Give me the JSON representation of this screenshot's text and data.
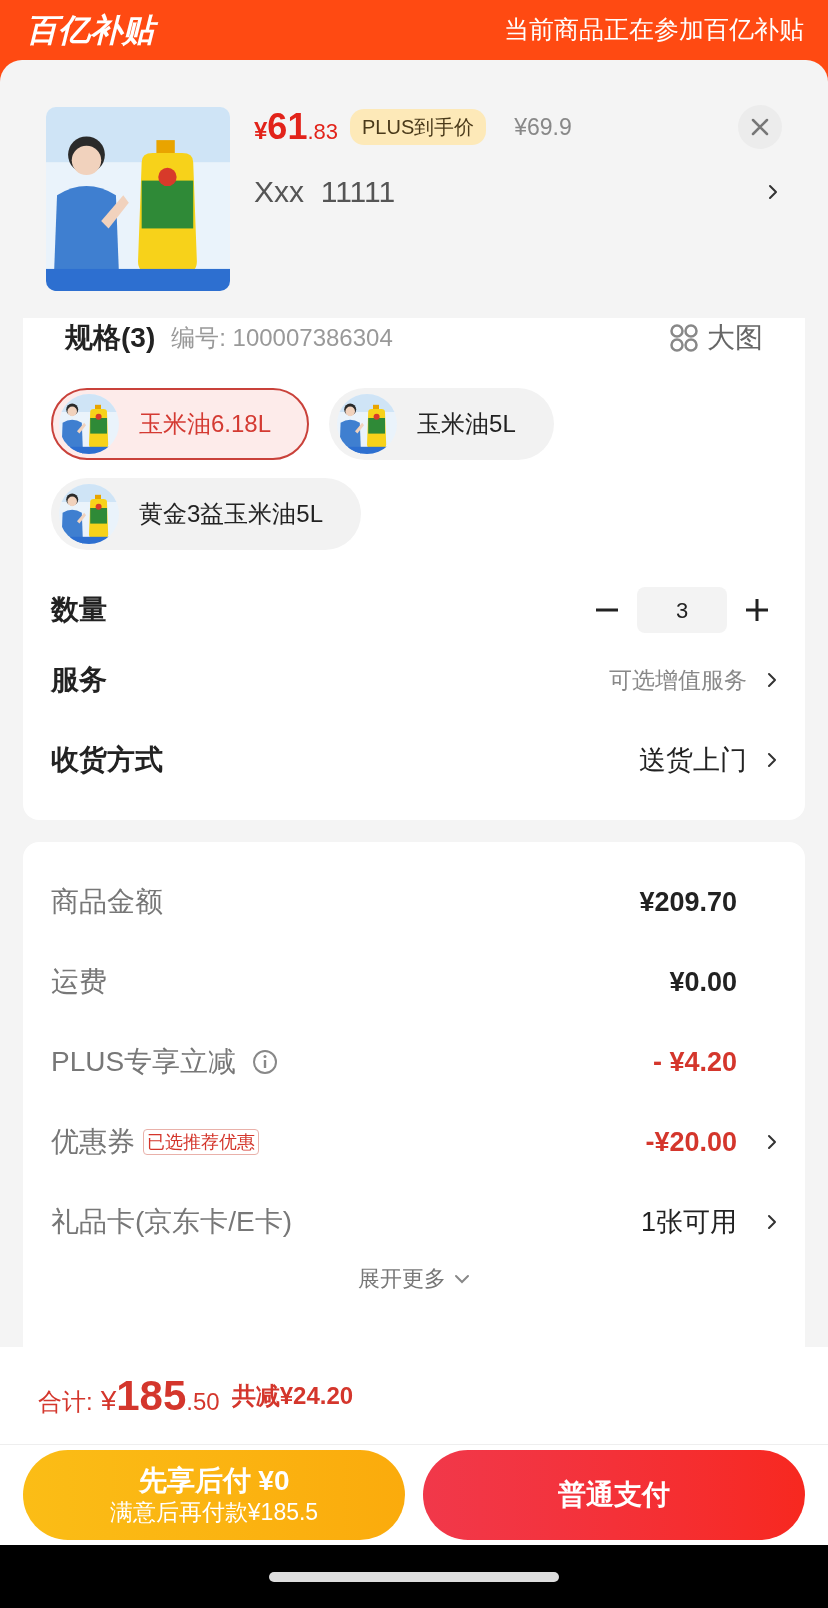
{
  "header": {
    "logo": "百亿补贴",
    "notice": "当前商品正在参加百亿补贴"
  },
  "product": {
    "price_symbol": "¥",
    "price_int": "61",
    "price_dec": ".83",
    "price_badge": "PLUS到手价",
    "original_price": "¥69.9",
    "name": "Xxx  11111"
  },
  "spec": {
    "title": "规格(3)",
    "code": "编号: 100007386304",
    "view_toggle": "大图",
    "options": [
      {
        "label": "玉米油6.18L",
        "selected": true
      },
      {
        "label": "玉米油5L",
        "selected": false
      },
      {
        "label": "黄金3益玉米油5L",
        "selected": false
      }
    ]
  },
  "quantity": {
    "label": "数量",
    "value": "3"
  },
  "options_rows": [
    {
      "label": "服务",
      "value": "可选增值服务",
      "kind": "hint"
    },
    {
      "label": "收货方式",
      "value": "送货上门",
      "kind": "value"
    }
  ],
  "summary": [
    {
      "label": "商品金额",
      "value": "¥209.70",
      "kind": "amount",
      "info_icon": false,
      "has_arrow": false
    },
    {
      "label": "运费",
      "value": "¥0.00",
      "kind": "amount",
      "info_icon": false,
      "has_arrow": false
    },
    {
      "label": "PLUS专享立减",
      "value": "- ¥4.20",
      "kind": "discount",
      "info_icon": true,
      "has_arrow": false
    },
    {
      "label": "优惠券",
      "tag": "已选推荐优惠",
      "value": "-¥20.00",
      "kind": "discount",
      "info_icon": false,
      "has_arrow": true
    },
    {
      "label": "礼品卡(京东卡/E卡)",
      "value": "1张可用",
      "kind": "plain",
      "info_icon": false,
      "has_arrow": true
    }
  ],
  "expand": "展开更多",
  "footer": {
    "total_label": "合计:",
    "total_symbol": "¥",
    "total_int": "185",
    "total_dec": ".50",
    "saved": "共减¥24.20",
    "buttons": [
      {
        "kind": "later",
        "title": "先享后付 ¥0",
        "subtitle": "满意后再付款¥185.5"
      },
      {
        "kind": "pay",
        "title": "普通支付"
      }
    ]
  }
}
